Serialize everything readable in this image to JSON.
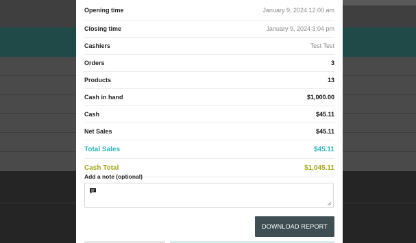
{
  "report": {
    "opening_time": {
      "label": "Opening time",
      "value": "January 9, 2024 12:00 am"
    },
    "closing_time": {
      "label": "Closing time",
      "value": "January 9, 2024 3:04 pm"
    },
    "cashiers": {
      "label": "Cashiers",
      "value": "Test Test"
    },
    "orders": {
      "label": "Orders",
      "value": "3"
    },
    "products": {
      "label": "Products",
      "value": "13"
    },
    "cash_in_hand": {
      "label": "Cash in hand",
      "value": "$1,000.00"
    },
    "cash": {
      "label": "Cash",
      "value": "$45.11"
    },
    "net_sales": {
      "label": "Net Sales",
      "value": "$45.11"
    },
    "total_sales": {
      "label": "Total Sales",
      "value": "$45.11"
    },
    "cash_total": {
      "label": "Cash Total",
      "value": "$1,045.11"
    }
  },
  "note": {
    "label": "Add a note (optional)",
    "icon": "comment-icon"
  },
  "actions": {
    "download_label": "DOWNLOAD REPORT"
  },
  "colors": {
    "total_sales": "#2db5b9",
    "cash_total": "#a3a61a",
    "button": "#3e4e52",
    "background_band": "#1f4a47"
  }
}
